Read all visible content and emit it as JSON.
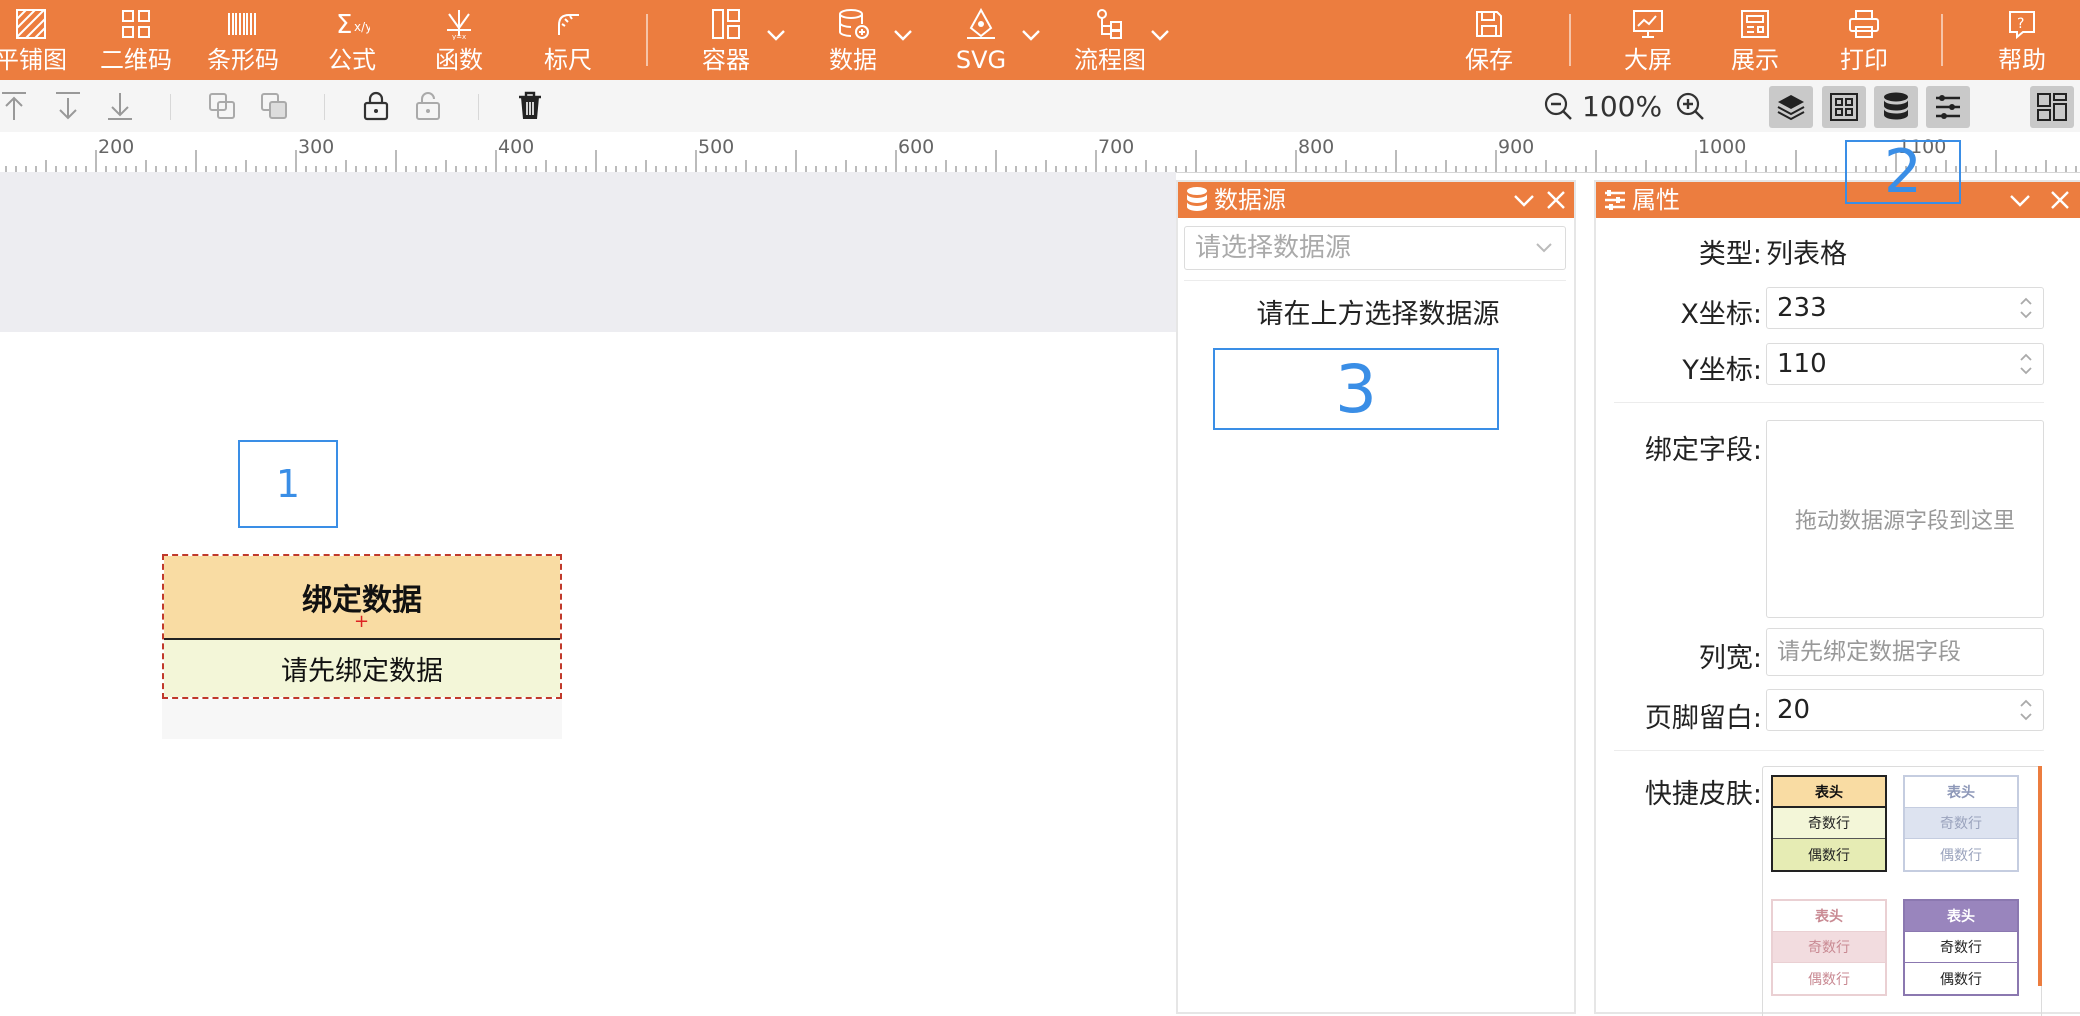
{
  "colors": {
    "brand": "#ec7d3f",
    "callout": "#3a8ee6",
    "head_fill": "#f9dca3",
    "row_fill": "#f3f6d8"
  },
  "topbar": {
    "left_items": [
      {
        "label": "平铺图",
        "icon": "tile-image-icon"
      },
      {
        "label": "二维码",
        "icon": "qrcode-icon"
      },
      {
        "label": "条形码",
        "icon": "barcode-icon"
      },
      {
        "label": "公式",
        "icon": "formula-icon"
      },
      {
        "label": "函数",
        "icon": "function-icon"
      },
      {
        "label": "标尺",
        "icon": "ruler-icon"
      }
    ],
    "dropdown_items": [
      {
        "label": "容器",
        "icon": "container-icon"
      },
      {
        "label": "数据",
        "icon": "database-add-icon"
      },
      {
        "label": "SVG",
        "icon": "pen-nib-icon"
      },
      {
        "label": "流程图",
        "icon": "flowchart-icon"
      }
    ],
    "right_items": [
      {
        "label": "保存",
        "icon": "save-icon"
      },
      {
        "label": "大屏",
        "icon": "big-screen-icon"
      },
      {
        "label": "展示",
        "icon": "display-icon"
      },
      {
        "label": "打印",
        "icon": "printer-icon"
      },
      {
        "label": "帮助",
        "icon": "help-icon"
      }
    ]
  },
  "toolbar": {
    "zoom": "100%"
  },
  "ruler": {
    "labels": [
      "200",
      "300",
      "400",
      "500",
      "600",
      "700",
      "800",
      "900",
      "1000",
      "1100"
    ]
  },
  "callouts": [
    "1",
    "2",
    "3"
  ],
  "table_widget": {
    "header": "绑定数据",
    "row": "请先绑定数据",
    "plus": "+"
  },
  "datasource_panel": {
    "title": "数据源",
    "select_placeholder": "请选择数据源",
    "hint": "请在上方选择数据源"
  },
  "property_panel": {
    "title": "属性",
    "type_label": "类型:",
    "type_value": "列表格",
    "x_label": "X坐标:",
    "x_value": "233",
    "y_label": "Y坐标:",
    "y_value": "110",
    "bind_label": "绑定字段:",
    "bind_hint": "拖动数据源字段到这里",
    "width_label": "列宽:",
    "width_placeholder": "请先绑定数据字段",
    "footer_label": "页脚留白:",
    "footer_value": "20",
    "skin_label": "快捷皮肤:",
    "skins": [
      {
        "head": "表头",
        "odd": "奇数行",
        "even": "偶数行"
      },
      {
        "head": "表头",
        "odd": "奇数行",
        "even": "偶数行"
      },
      {
        "head": "表头",
        "odd": "奇数行",
        "even": "偶数行"
      },
      {
        "head": "表头",
        "odd": "奇数行",
        "even": "偶数行"
      }
    ]
  }
}
